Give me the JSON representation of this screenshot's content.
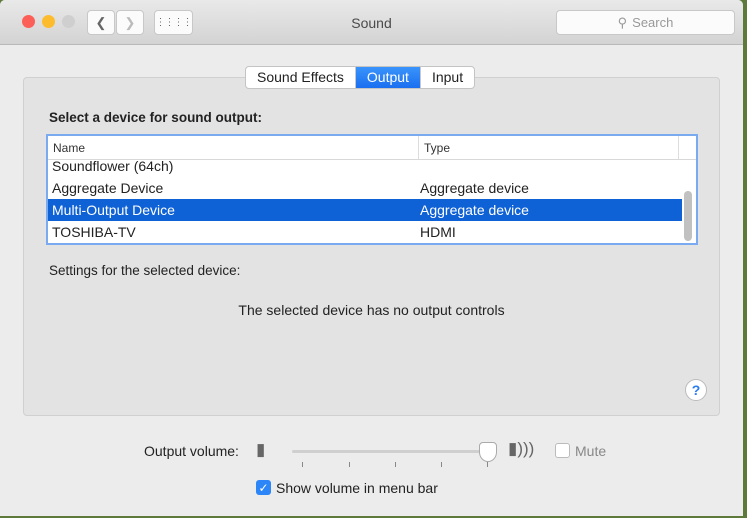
{
  "window": {
    "title": "Sound",
    "search_placeholder": "Search"
  },
  "tabs": [
    {
      "label": "Sound Effects",
      "active": false
    },
    {
      "label": "Output",
      "active": true
    },
    {
      "label": "Input",
      "active": false
    }
  ],
  "output": {
    "heading": "Select a device for sound output:",
    "columns": [
      "Name",
      "Type"
    ],
    "rows": [
      {
        "name": "Soundflower (64ch)",
        "type": "",
        "selected": false
      },
      {
        "name": "Aggregate Device",
        "type": "Aggregate device",
        "selected": false
      },
      {
        "name": "Multi-Output Device",
        "type": "Aggregate device",
        "selected": true
      },
      {
        "name": "TOSHIBA-TV",
        "type": "HDMI",
        "selected": false
      }
    ],
    "settings_label": "Settings for the selected device:",
    "no_controls": "The selected device has no output controls",
    "help": "?"
  },
  "volume": {
    "label": "Output volume:",
    "level_percent": 100,
    "mute_label": "Mute",
    "muted": false,
    "show_in_menu_bar_label": "Show volume in menu bar",
    "show_in_menu_bar": true
  },
  "colors": {
    "accent": "#1a6ff0",
    "selection": "#0f62d6"
  }
}
